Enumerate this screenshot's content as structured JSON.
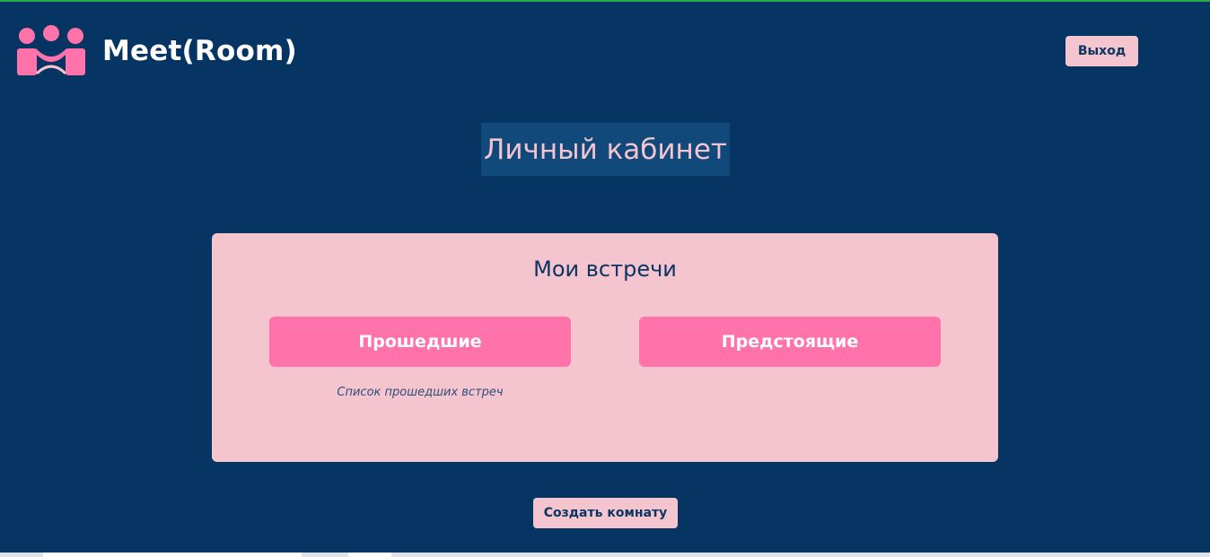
{
  "app": {
    "brand": "Meet(Room)",
    "logo_icon": "people-group-icon"
  },
  "header": {
    "logout_label": "Выход"
  },
  "page": {
    "title": "Личный кабинет"
  },
  "meetings_card": {
    "title": "Мои встречи",
    "past_button_label": "Прошедшие",
    "upcoming_button_label": "Предстоящие",
    "past_caption": "Список прошедших встреч"
  },
  "actions": {
    "create_room_label": "Создать комнату"
  },
  "colors": {
    "background": "#063563",
    "accent_pink": "#ff73aa",
    "light_pink": "#f4c4cf",
    "title_bg": "#10497a",
    "text_dark": "#0b3563"
  }
}
